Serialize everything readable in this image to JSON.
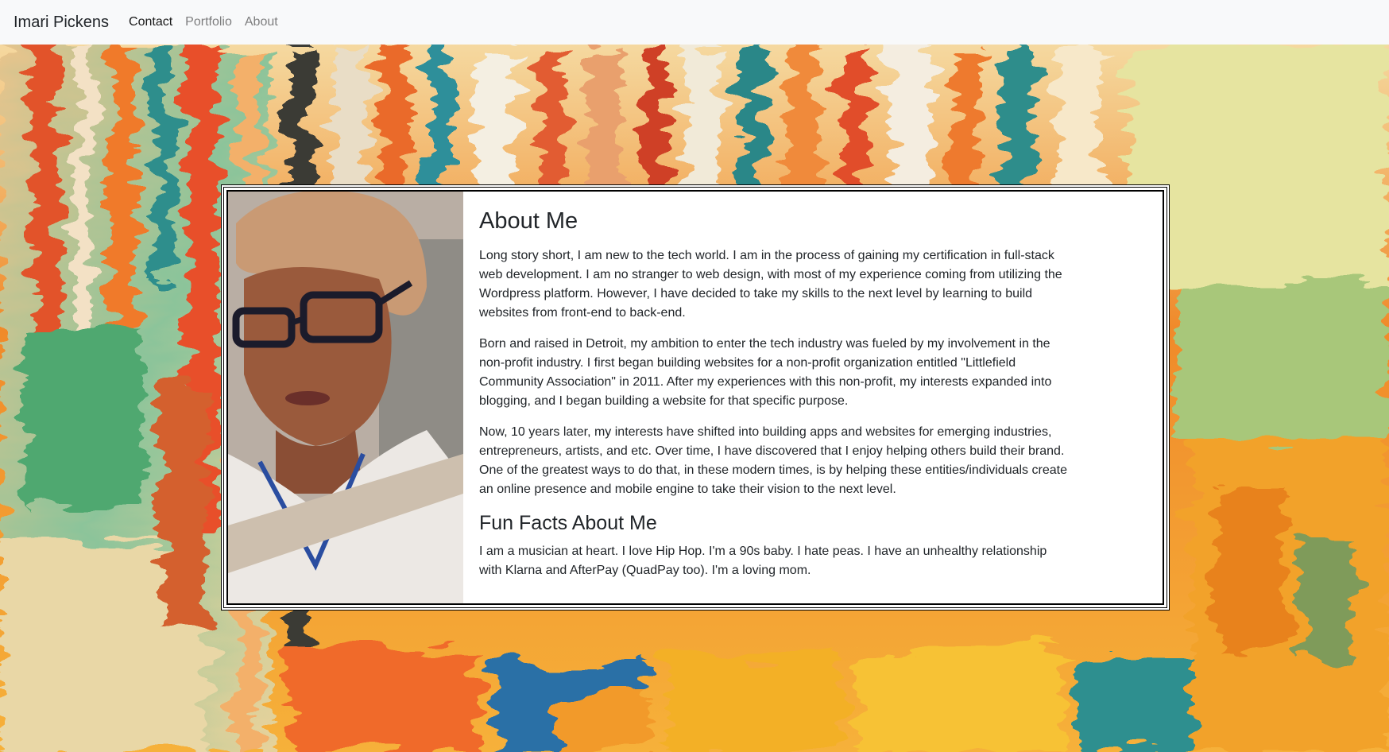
{
  "navbar": {
    "brand": "Imari Pickens",
    "links": [
      "Contact",
      "Portfolio",
      "About"
    ],
    "active_index": 0
  },
  "about": {
    "heading": "About Me",
    "paragraphs": [
      "Long story short, I am new to the tech world. I am in the process of gaining my certification in full-stack web development. I am no stranger to web design, with most of my experience coming from utilizing the Wordpress platform. However, I have decided to take my skills to the next level by learning to build websites from front-end to back-end.",
      "Born and raised in Detroit, my ambition to enter the tech industry was fueled by my involvement in the non-profit industry. I first began building websites for a non-profit organization entitled \"Littlefield Community Association\" in 2011. After my experiences with this non-profit, my interests expanded into blogging, and I began building a website for that specific purpose.",
      "Now, 10 years later, my interests have shifted into building apps and websites for emerging industries, entrepreneurs, artists, and etc. Over time, I have discovered that I enjoy helping others build their brand. One of the greatest ways to do that, in these modern times, is by helping these entities/individuals create an online presence and mobile engine to take their vision to the next level."
    ],
    "fun_heading": "Fun Facts About Me",
    "fun_text": "I am a musician at heart. I love Hip Hop. I'm a 90s baby. I hate peas. I have an unhealthy relationship with Klarna and AfterPay (QuadPay too). I'm a loving mom."
  },
  "colors": {
    "navbar_bg": "#f8f9fa",
    "text": "#212529",
    "nav_muted": "rgba(0,0,0,0.5)",
    "nav_active": "rgba(0,0,0,0.9)"
  }
}
